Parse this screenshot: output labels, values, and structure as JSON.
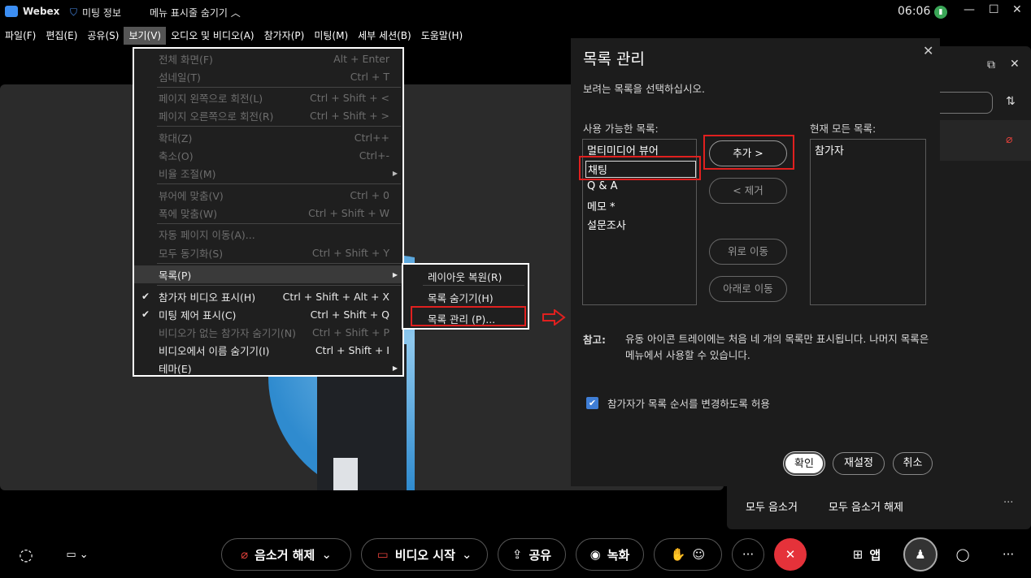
{
  "titlebar": {
    "app_name": "Webex",
    "meeting_info": "미팅 정보",
    "menu_toggle": "메뉴 표시줄 숨기기",
    "time": "06:06"
  },
  "menubar": [
    "파일(F)",
    "편집(E)",
    "공유(S)",
    "보기(V)",
    "오디오 및 비디오(A)",
    "참가자(P)",
    "미팅(M)",
    "세부 세션(B)",
    "도움말(H)"
  ],
  "view_menu": {
    "items": [
      {
        "label": "전체 화면(F)",
        "shortcut": "Alt + Enter"
      },
      {
        "label": "섬네일(T)",
        "shortcut": "Ctrl + T"
      },
      {
        "label": "페이지 왼쪽으로 회전(L)",
        "shortcut": "Ctrl + Shift + <"
      },
      {
        "label": "페이지 오른쪽으로 회전(R)",
        "shortcut": "Ctrl + Shift + >"
      },
      {
        "label": "확대(Z)",
        "shortcut": "Ctrl++"
      },
      {
        "label": "축소(O)",
        "shortcut": "Ctrl+-"
      },
      {
        "label": "비율 조절(M)",
        "shortcut": ""
      },
      {
        "label": "뷰어에 맞춤(V)",
        "shortcut": "Ctrl + 0"
      },
      {
        "label": "폭에 맞춤(W)",
        "shortcut": "Ctrl + Shift + W"
      },
      {
        "label": "자동 페이지 이동(A)...",
        "shortcut": ""
      },
      {
        "label": "모두 동기화(S)",
        "shortcut": "Ctrl + Shift + Y"
      },
      {
        "label": "목록(P)",
        "shortcut": ""
      },
      {
        "label": "참가자 비디오 표시(H)",
        "shortcut": "Ctrl + Shift + Alt + X"
      },
      {
        "label": "미팅 제어 표시(C)",
        "shortcut": "Ctrl + Shift + Q"
      },
      {
        "label": "비디오가 없는 참가자 숨기기(N)",
        "shortcut": "Ctrl + Shift + P"
      },
      {
        "label": "비디오에서 이름 숨기기(I)",
        "shortcut": "Ctrl + Shift + I"
      },
      {
        "label": "테마(E)",
        "shortcut": ""
      }
    ]
  },
  "submenu": {
    "items": [
      "레이아웃 복원(R)",
      "목록 숨기기(H)",
      "목록 관리 (P)..."
    ]
  },
  "dialog": {
    "title": "목록 관리",
    "subtitle": "보려는 목록을 선택하십시오.",
    "available_label": "사용 가능한 목록:",
    "current_label": "현재 모든 목록:",
    "available_items": [
      "멀티미디어 뷰어",
      "채팅",
      "Q & A",
      "메모 *",
      "설문조사"
    ],
    "current_items": [
      "참가자"
    ],
    "add_button": "추가 >",
    "remove_button": "< 제거",
    "move_up_button": "위로 이동",
    "move_down_button": "아래로 이동",
    "note_label": "참고:",
    "note_text": "유동 아이콘 트레이에는 처음 네 개의 목록만 표시됩니다. 나머지 목록은 메뉴에서 사용할 수 있습니다.",
    "checkbox_label": "참가자가 목록 순서를 변경하도록 허용",
    "ok_button": "확인",
    "reset_button": "재설정",
    "cancel_button": "취소"
  },
  "participants_panel": {
    "mute_all": "모두 음소거",
    "unmute_all": "모두 음소거 해제"
  },
  "toolbar": {
    "unmute": "음소거 해제",
    "start_video": "비디오 시작",
    "share": "공유",
    "record": "녹화",
    "apps": "앱"
  }
}
